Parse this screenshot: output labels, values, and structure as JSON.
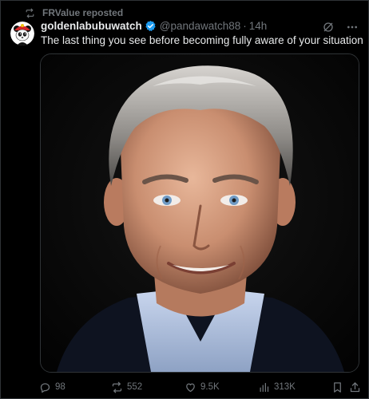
{
  "repost": {
    "label": "FRValue reposted",
    "icon": "repost-icon"
  },
  "tweet": {
    "display_name": "goldenlabubuwatch",
    "verified": true,
    "handle": "@pandawatch88",
    "separator": "·",
    "time": "14h",
    "text": "The last thing you see before becoming fully aware of your situation",
    "media_alt": "Close-up portrait photo of a smiling gray-haired man against a black background"
  },
  "actions": {
    "replies": "98",
    "reposts": "552",
    "likes": "9.5K",
    "views": "313K"
  },
  "colors": {
    "background": "#000000",
    "text_primary": "#e7e9ea",
    "text_secondary": "#71767b",
    "verified_blue": "#1d9bf0",
    "border": "#2f3336"
  }
}
